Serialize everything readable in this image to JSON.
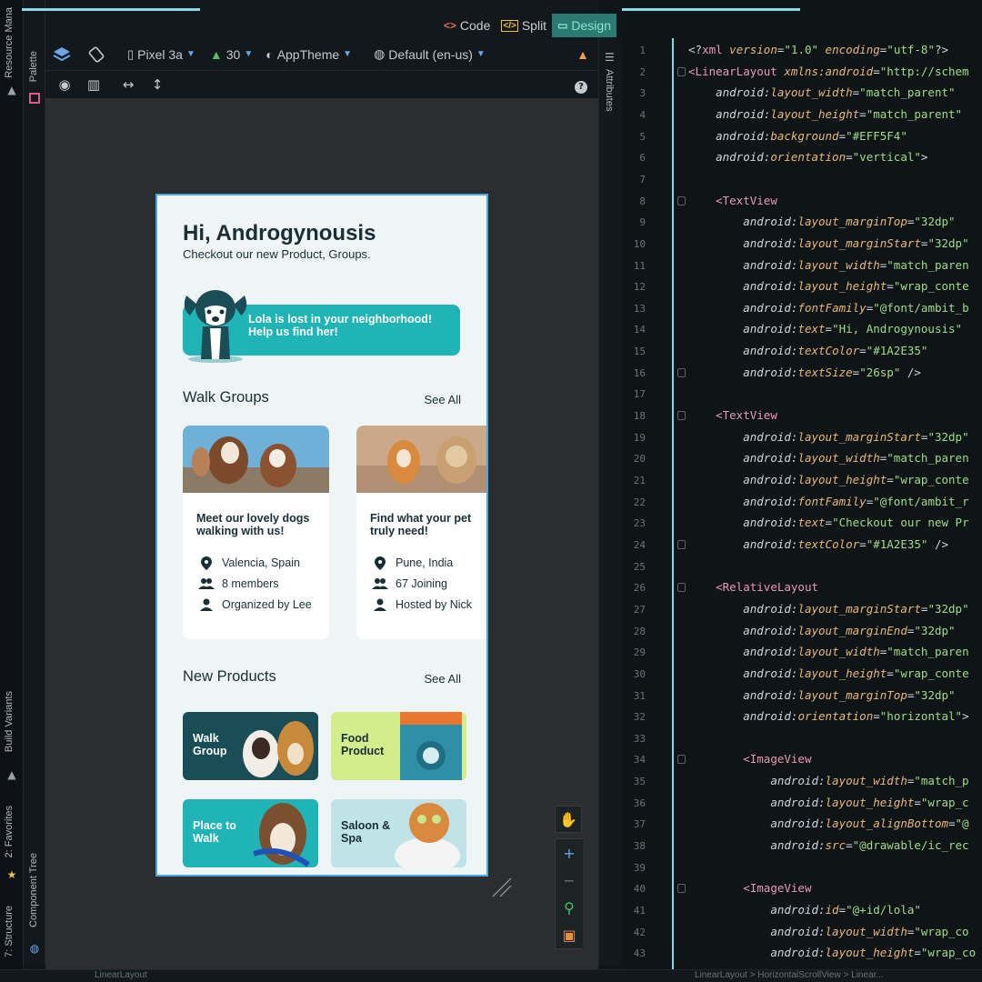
{
  "view_modes": [
    {
      "label": "Code",
      "glyph": "<>"
    },
    {
      "label": "Split",
      "glyph": "</>"
    },
    {
      "label": "Design",
      "glyph": "▭"
    }
  ],
  "toolbar": {
    "device": "Pixel 3a",
    "api": "30",
    "theme": "AppTheme",
    "locale": "Default (en-us)"
  },
  "side_tabs": {
    "resource_manager": "Resource Mana",
    "palette": "Palette",
    "build_variants": "Build Variants",
    "favorites": "2: Favorites",
    "structure": "7: Structure",
    "component_tree": "Component Tree",
    "attributes": "Attributes"
  },
  "phone": {
    "greeting": "Hi, Androgynousis",
    "subgreeting": "Checkout our new Product, Groups.",
    "banner_text": "Lola is lost in your neighborhood! Help us find her!",
    "walk_groups_title": "Walk Groups",
    "see_all": "See All",
    "walk_cards": [
      {
        "title": "Meet our lovely dogs walking with us!",
        "location": "Valencia, Spain",
        "members": "8 members",
        "organizer": "Organized by Lee"
      },
      {
        "title": "Find what your pet truly need!",
        "location": "Pune, India",
        "members": "67 Joining",
        "organizer": "Hosted by Nick"
      }
    ],
    "new_products_title": "New Products",
    "products": [
      {
        "label": "Walk Group",
        "color": "#1a4d55",
        "text_color": "#ffffff"
      },
      {
        "label": "Food Product",
        "color": "#d3ec8c",
        "text_color": "#1a2e35"
      },
      {
        "label": "Place to Walk",
        "color": "#20b4b6",
        "text_color": "#ffffff"
      },
      {
        "label": "Saloon & Spa",
        "color": "#bfe3e6",
        "text_color": "#1a2e35"
      }
    ]
  },
  "status": {
    "left": "LinearLayout",
    "right": "LinearLayout > HorizontalScrollView > Linear..."
  },
  "code_lines": [
    {
      "n": "1",
      "parts": [
        [
          "t-pun",
          "<?"
        ],
        [
          "t-tag",
          "xml "
        ],
        [
          "t-attr",
          "version"
        ],
        [
          "t-pun",
          "="
        ],
        [
          "t-val",
          "\"1.0\" "
        ],
        [
          "t-attr",
          "encoding"
        ],
        [
          "t-pun",
          "="
        ],
        [
          "t-val",
          "\"utf-8\""
        ],
        [
          "t-pun",
          "?>"
        ]
      ]
    },
    {
      "n": "2",
      "parts": [
        [
          "t-tag",
          "<LinearLayout "
        ],
        [
          "t-attr",
          "xmlns:android"
        ],
        [
          "t-pun",
          "="
        ],
        [
          "t-val",
          "\"http://schem"
        ]
      ]
    },
    {
      "n": "3",
      "parts": [
        [
          "t-pun",
          "    "
        ],
        [
          "t-ns",
          "android:"
        ],
        [
          "t-attr",
          "layout_width"
        ],
        [
          "t-pun",
          "="
        ],
        [
          "t-val",
          "\"match_parent\""
        ]
      ]
    },
    {
      "n": "4",
      "parts": [
        [
          "t-pun",
          "    "
        ],
        [
          "t-ns",
          "android:"
        ],
        [
          "t-attr",
          "layout_height"
        ],
        [
          "t-pun",
          "="
        ],
        [
          "t-val",
          "\"match_parent\""
        ]
      ]
    },
    {
      "n": "5",
      "parts": [
        [
          "t-pun",
          "    "
        ],
        [
          "t-ns",
          "android:"
        ],
        [
          "t-attr",
          "background"
        ],
        [
          "t-pun",
          "="
        ],
        [
          "t-val",
          "\"#EFF5F4\""
        ]
      ]
    },
    {
      "n": "6",
      "parts": [
        [
          "t-pun",
          "    "
        ],
        [
          "t-ns",
          "android:"
        ],
        [
          "t-attr",
          "orientation"
        ],
        [
          "t-pun",
          "="
        ],
        [
          "t-val",
          "\"vertical\""
        ],
        [
          "t-pun",
          ">"
        ]
      ]
    },
    {
      "n": "7",
      "parts": []
    },
    {
      "n": "8",
      "parts": [
        [
          "t-pun",
          "    "
        ],
        [
          "t-tag",
          "<TextView"
        ]
      ]
    },
    {
      "n": "9",
      "parts": [
        [
          "t-pun",
          "        "
        ],
        [
          "t-ns",
          "android:"
        ],
        [
          "t-attr",
          "layout_marginTop"
        ],
        [
          "t-pun",
          "="
        ],
        [
          "t-val",
          "\"32dp\""
        ]
      ]
    },
    {
      "n": "10",
      "parts": [
        [
          "t-pun",
          "        "
        ],
        [
          "t-ns",
          "android:"
        ],
        [
          "t-attr",
          "layout_marginStart"
        ],
        [
          "t-pun",
          "="
        ],
        [
          "t-val",
          "\"32dp\""
        ]
      ]
    },
    {
      "n": "11",
      "parts": [
        [
          "t-pun",
          "        "
        ],
        [
          "t-ns",
          "android:"
        ],
        [
          "t-attr",
          "layout_width"
        ],
        [
          "t-pun",
          "="
        ],
        [
          "t-val",
          "\"match_paren"
        ]
      ]
    },
    {
      "n": "12",
      "parts": [
        [
          "t-pun",
          "        "
        ],
        [
          "t-ns",
          "android:"
        ],
        [
          "t-attr",
          "layout_height"
        ],
        [
          "t-pun",
          "="
        ],
        [
          "t-val",
          "\"wrap_conte"
        ]
      ]
    },
    {
      "n": "13",
      "parts": [
        [
          "t-pun",
          "        "
        ],
        [
          "t-ns",
          "android:"
        ],
        [
          "t-attr",
          "fontFamily"
        ],
        [
          "t-pun",
          "="
        ],
        [
          "t-val",
          "\"@font/ambit_b"
        ]
      ]
    },
    {
      "n": "14",
      "parts": [
        [
          "t-pun",
          "        "
        ],
        [
          "t-ns",
          "android:"
        ],
        [
          "t-attr",
          "text"
        ],
        [
          "t-pun",
          "="
        ],
        [
          "t-val",
          "\"Hi, Androgynousis\""
        ]
      ]
    },
    {
      "n": "15",
      "parts": [
        [
          "t-pun",
          "        "
        ],
        [
          "t-ns",
          "android:"
        ],
        [
          "t-attr",
          "textColor"
        ],
        [
          "t-pun",
          "="
        ],
        [
          "t-val",
          "\"#1A2E35\""
        ]
      ]
    },
    {
      "n": "16",
      "parts": [
        [
          "t-pun",
          "        "
        ],
        [
          "t-ns",
          "android:"
        ],
        [
          "t-attr",
          "textSize"
        ],
        [
          "t-pun",
          "="
        ],
        [
          "t-val",
          "\"26sp\" "
        ],
        [
          "t-pun",
          "/>"
        ]
      ]
    },
    {
      "n": "17",
      "parts": []
    },
    {
      "n": "18",
      "parts": [
        [
          "t-pun",
          "    "
        ],
        [
          "t-tag",
          "<TextView"
        ]
      ]
    },
    {
      "n": "19",
      "parts": [
        [
          "t-pun",
          "        "
        ],
        [
          "t-ns",
          "android:"
        ],
        [
          "t-attr",
          "layout_marginStart"
        ],
        [
          "t-pun",
          "="
        ],
        [
          "t-val",
          "\"32dp\""
        ]
      ]
    },
    {
      "n": "20",
      "parts": [
        [
          "t-pun",
          "        "
        ],
        [
          "t-ns",
          "android:"
        ],
        [
          "t-attr",
          "layout_width"
        ],
        [
          "t-pun",
          "="
        ],
        [
          "t-val",
          "\"match_paren"
        ]
      ]
    },
    {
      "n": "21",
      "parts": [
        [
          "t-pun",
          "        "
        ],
        [
          "t-ns",
          "android:"
        ],
        [
          "t-attr",
          "layout_height"
        ],
        [
          "t-pun",
          "="
        ],
        [
          "t-val",
          "\"wrap_conte"
        ]
      ]
    },
    {
      "n": "22",
      "parts": [
        [
          "t-pun",
          "        "
        ],
        [
          "t-ns",
          "android:"
        ],
        [
          "t-attr",
          "fontFamily"
        ],
        [
          "t-pun",
          "="
        ],
        [
          "t-val",
          "\"@font/ambit_r"
        ]
      ]
    },
    {
      "n": "23",
      "parts": [
        [
          "t-pun",
          "        "
        ],
        [
          "t-ns",
          "android:"
        ],
        [
          "t-attr",
          "text"
        ],
        [
          "t-pun",
          "="
        ],
        [
          "t-val",
          "\"Checkout our new Pr"
        ]
      ]
    },
    {
      "n": "24",
      "parts": [
        [
          "t-pun",
          "        "
        ],
        [
          "t-ns",
          "android:"
        ],
        [
          "t-attr",
          "textColor"
        ],
        [
          "t-pun",
          "="
        ],
        [
          "t-val",
          "\"#1A2E35\" "
        ],
        [
          "t-pun",
          "/>"
        ]
      ]
    },
    {
      "n": "25",
      "parts": []
    },
    {
      "n": "26",
      "parts": [
        [
          "t-pun",
          "    "
        ],
        [
          "t-tag",
          "<RelativeLayout"
        ]
      ]
    },
    {
      "n": "27",
      "parts": [
        [
          "t-pun",
          "        "
        ],
        [
          "t-ns",
          "android:"
        ],
        [
          "t-attr",
          "layout_marginStart"
        ],
        [
          "t-pun",
          "="
        ],
        [
          "t-val",
          "\"32dp\""
        ]
      ]
    },
    {
      "n": "28",
      "parts": [
        [
          "t-pun",
          "        "
        ],
        [
          "t-ns",
          "android:"
        ],
        [
          "t-attr",
          "layout_marginEnd"
        ],
        [
          "t-pun",
          "="
        ],
        [
          "t-val",
          "\"32dp\""
        ]
      ]
    },
    {
      "n": "29",
      "parts": [
        [
          "t-pun",
          "        "
        ],
        [
          "t-ns",
          "android:"
        ],
        [
          "t-attr",
          "layout_width"
        ],
        [
          "t-pun",
          "="
        ],
        [
          "t-val",
          "\"match_paren"
        ]
      ]
    },
    {
      "n": "30",
      "parts": [
        [
          "t-pun",
          "        "
        ],
        [
          "t-ns",
          "android:"
        ],
        [
          "t-attr",
          "layout_height"
        ],
        [
          "t-pun",
          "="
        ],
        [
          "t-val",
          "\"wrap_conte"
        ]
      ]
    },
    {
      "n": "31",
      "parts": [
        [
          "t-pun",
          "        "
        ],
        [
          "t-ns",
          "android:"
        ],
        [
          "t-attr",
          "layout_marginTop"
        ],
        [
          "t-pun",
          "="
        ],
        [
          "t-val",
          "\"32dp\""
        ]
      ]
    },
    {
      "n": "32",
      "parts": [
        [
          "t-pun",
          "        "
        ],
        [
          "t-ns",
          "android:"
        ],
        [
          "t-attr",
          "orientation"
        ],
        [
          "t-pun",
          "="
        ],
        [
          "t-val",
          "\"horizontal\""
        ],
        [
          "t-pun",
          ">"
        ]
      ]
    },
    {
      "n": "33",
      "parts": []
    },
    {
      "n": "34",
      "parts": [
        [
          "t-pun",
          "        "
        ],
        [
          "t-tag",
          "<ImageView"
        ]
      ]
    },
    {
      "n": "35",
      "parts": [
        [
          "t-pun",
          "            "
        ],
        [
          "t-ns",
          "android:"
        ],
        [
          "t-attr",
          "layout_width"
        ],
        [
          "t-pun",
          "="
        ],
        [
          "t-val",
          "\"match_p"
        ]
      ]
    },
    {
      "n": "36",
      "parts": [
        [
          "t-pun",
          "            "
        ],
        [
          "t-ns",
          "android:"
        ],
        [
          "t-attr",
          "layout_height"
        ],
        [
          "t-pun",
          "="
        ],
        [
          "t-val",
          "\"wrap_c"
        ]
      ]
    },
    {
      "n": "37",
      "parts": [
        [
          "t-pun",
          "            "
        ],
        [
          "t-ns",
          "android:"
        ],
        [
          "t-attr",
          "layout_alignBottom"
        ],
        [
          "t-pun",
          "="
        ],
        [
          "t-val",
          "\"@"
        ]
      ]
    },
    {
      "n": "38",
      "parts": [
        [
          "t-pun",
          "            "
        ],
        [
          "t-ns",
          "android:"
        ],
        [
          "t-attr",
          "src"
        ],
        [
          "t-pun",
          "="
        ],
        [
          "t-val",
          "\"@drawable/ic_rec"
        ]
      ]
    },
    {
      "n": "39",
      "parts": []
    },
    {
      "n": "40",
      "parts": [
        [
          "t-pun",
          "        "
        ],
        [
          "t-tag",
          "<ImageView"
        ]
      ]
    },
    {
      "n": "41",
      "parts": [
        [
          "t-pun",
          "            "
        ],
        [
          "t-ns",
          "android:"
        ],
        [
          "t-attr",
          "id"
        ],
        [
          "t-pun",
          "="
        ],
        [
          "t-val",
          "\"@+id/lola\""
        ]
      ]
    },
    {
      "n": "42",
      "parts": [
        [
          "t-pun",
          "            "
        ],
        [
          "t-ns",
          "android:"
        ],
        [
          "t-attr",
          "layout_width"
        ],
        [
          "t-pun",
          "="
        ],
        [
          "t-val",
          "\"wrap_co"
        ]
      ]
    },
    {
      "n": "43",
      "parts": [
        [
          "t-pun",
          "            "
        ],
        [
          "t-ns",
          "android:"
        ],
        [
          "t-attr",
          "layout_height"
        ],
        [
          "t-pun",
          "="
        ],
        [
          "t-val",
          "\"wrap_co"
        ]
      ]
    }
  ],
  "colors": {
    "accent_teal": "#20b4b6",
    "text_dark": "#1a2e35",
    "phone_bg": "#eff5f4",
    "selection_blue": "#4aa8e8"
  }
}
